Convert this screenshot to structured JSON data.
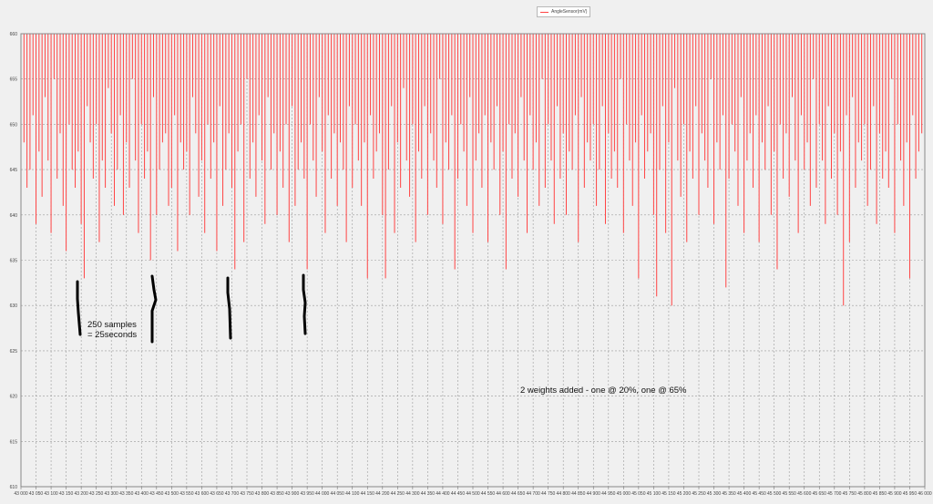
{
  "chart_data": {
    "type": "bar",
    "title": "",
    "legend": {
      "label": "AngleSensor(mV)",
      "color": "#ff4444",
      "position": "top-center"
    },
    "xlabel": "",
    "ylabel": "",
    "ylim": [
      610,
      660
    ],
    "y_ticks": [
      "610",
      "615",
      "620",
      "625",
      "630",
      "635",
      "640",
      "645",
      "650",
      "655",
      "660"
    ],
    "x_tick_labels": [
      "43 000",
      "43 050",
      "43 100",
      "43 150",
      "43 200",
      "43 250",
      "43 300",
      "43 350",
      "43 400",
      "43 450",
      "43 500",
      "43 550",
      "43 600",
      "43 650",
      "43 700",
      "43 750",
      "43 800",
      "43 850",
      "43 900",
      "43 950",
      "44 000",
      "44 050",
      "44 100",
      "44 150",
      "44 200",
      "44 250",
      "44 300",
      "44 350",
      "44 400",
      "44 450",
      "44 500",
      "44 550",
      "44 600",
      "44 650",
      "44 700",
      "44 750",
      "44 800",
      "44 850",
      "44 900",
      "44 950",
      "45 000",
      "45 050",
      "45 100",
      "45 150",
      "45 200",
      "45 250",
      "45 300",
      "45 350",
      "45 400",
      "45 450",
      "45 500",
      "45 550",
      "45 600",
      "45 650",
      "45 700",
      "45 750",
      "45 800",
      "45 850",
      "45 900",
      "45 950",
      "46 000"
    ],
    "x_range": [
      43000,
      46000
    ],
    "grid": true,
    "series": [
      {
        "name": "AngleSensor(mV)",
        "x": [
          43000,
          43010,
          43020,
          43030,
          43040,
          43050,
          43060,
          43070,
          43080,
          43090,
          43100,
          43110,
          43120,
          43130,
          43140,
          43150,
          43160,
          43170,
          43180,
          43190,
          43200,
          43210,
          43220,
          43230,
          43240,
          43250,
          43260,
          43270,
          43280,
          43290,
          43300,
          43310,
          43320,
          43330,
          43340,
          43350,
          43360,
          43370,
          43380,
          43390,
          43400,
          43410,
          43420,
          43430,
          43440,
          43450,
          43460,
          43470,
          43480,
          43490,
          43500,
          43510,
          43520,
          43530,
          43540,
          43550,
          43560,
          43570,
          43580,
          43590,
          43600,
          43610,
          43620,
          43630,
          43640,
          43650,
          43660,
          43670,
          43680,
          43690,
          43700,
          43710,
          43720,
          43730,
          43740,
          43750,
          43760,
          43770,
          43780,
          43790,
          43800,
          43810,
          43820,
          43830,
          43840,
          43850,
          43860,
          43870,
          43880,
          43890,
          43900,
          43910,
          43920,
          43930,
          43940,
          43950,
          43960,
          43970,
          43980,
          43990,
          44000,
          44010,
          44020,
          44030,
          44040,
          44050,
          44060,
          44070,
          44080,
          44090,
          44100,
          44110,
          44120,
          44130,
          44140,
          44150,
          44160,
          44170,
          44180,
          44190,
          44200,
          44210,
          44220,
          44230,
          44240,
          44250,
          44260,
          44270,
          44280,
          44290,
          44300,
          44310,
          44320,
          44330,
          44340,
          44350,
          44360,
          44370,
          44380,
          44390,
          44400,
          44410,
          44420,
          44430,
          44440,
          44450,
          44460,
          44470,
          44480,
          44490,
          44500,
          44510,
          44520,
          44530,
          44540,
          44550,
          44560,
          44570,
          44580,
          44590,
          44600,
          44610,
          44620,
          44630,
          44640,
          44650,
          44660,
          44670,
          44680,
          44690,
          44700,
          44710,
          44720,
          44730,
          44740,
          44750,
          44760,
          44770,
          44780,
          44790,
          44800,
          44810,
          44820,
          44830,
          44840,
          44850,
          44860,
          44870,
          44880,
          44890,
          44900,
          44910,
          44920,
          44930,
          44940,
          44950,
          44960,
          44970,
          44980,
          44990,
          45000,
          45010,
          45020,
          45030,
          45040,
          45050,
          45060,
          45070,
          45080,
          45090,
          45100,
          45110,
          45120,
          45130,
          45140,
          45150,
          45160,
          45170,
          45180,
          45190,
          45200,
          45210,
          45220,
          45230,
          45240,
          45250,
          45260,
          45270,
          45280,
          45290,
          45300,
          45310,
          45320,
          45330,
          45340,
          45350,
          45360,
          45370,
          45380,
          45390,
          45400,
          45410,
          45420,
          45430,
          45440,
          45450,
          45460,
          45470,
          45480,
          45490,
          45500,
          45510,
          45520,
          45530,
          45540,
          45550,
          45560,
          45570,
          45580,
          45590,
          45600,
          45610,
          45620,
          45630,
          45640,
          45650,
          45660,
          45670,
          45680,
          45690,
          45700,
          45710,
          45720,
          45730,
          45740,
          45750,
          45760,
          45770,
          45780,
          45790,
          45800,
          45810,
          45820,
          45830,
          45840,
          45850,
          45860,
          45870,
          45880,
          45890,
          45900,
          45910,
          45920,
          45930,
          45940,
          45950,
          45960,
          45970,
          45980,
          45990
        ],
        "values": [
          634,
          648,
          643,
          645,
          651,
          639,
          647,
          642,
          653,
          646,
          638,
          655,
          644,
          649,
          641,
          636,
          650,
          645,
          643,
          647,
          639,
          633,
          652,
          648,
          644,
          650,
          637,
          646,
          643,
          654,
          649,
          641,
          645,
          651,
          640,
          648,
          643,
          655,
          646,
          638,
          650,
          644,
          647,
          635,
          653,
          640,
          645,
          648,
          649,
          641,
          643,
          651,
          636,
          648,
          645,
          647,
          640,
          653,
          649,
          642,
          646,
          638,
          650,
          644,
          648,
          636,
          652,
          641,
          645,
          649,
          643,
          634,
          647,
          650,
          637,
          655,
          644,
          648,
          642,
          651,
          646,
          639,
          653,
          645,
          649,
          640,
          647,
          643,
          650,
          637,
          652,
          641,
          645,
          648,
          644,
          634,
          650,
          646,
          642,
          653,
          647,
          638,
          651,
          644,
          649,
          641,
          648,
          645,
          637,
          652,
          643,
          650,
          646,
          641,
          648,
          633,
          651,
          644,
          647,
          649,
          640,
          633,
          645,
          652,
          638,
          648,
          643,
          654,
          646,
          642,
          650,
          637,
          647,
          644,
          652,
          640,
          649,
          646,
          643,
          655,
          639,
          648,
          645,
          651,
          634,
          644,
          650,
          647,
          641,
          653,
          638,
          646,
          649,
          643,
          651,
          637,
          648,
          645,
          652,
          640,
          647,
          634,
          650,
          644,
          649,
          642,
          653,
          646,
          638,
          651,
          645,
          648,
          641,
          655,
          643,
          650,
          646,
          639,
          652,
          644,
          649,
          640,
          647,
          645,
          651,
          637,
          653,
          643,
          648,
          646,
          650,
          641,
          645,
          652,
          639,
          649,
          644,
          647,
          643,
          655,
          638,
          650,
          646,
          641,
          648,
          633,
          651,
          644,
          647,
          649,
          640,
          631,
          645,
          652,
          638,
          648,
          630,
          654,
          646,
          642,
          650,
          637,
          647,
          644,
          652,
          640,
          649,
          646,
          643,
          655,
          639,
          648,
          645,
          651,
          632,
          644,
          650,
          647,
          641,
          653,
          638,
          646,
          649,
          643,
          651,
          637,
          648,
          645,
          652,
          640,
          647,
          634,
          650,
          644,
          649,
          642,
          653,
          646,
          638,
          651,
          645,
          648,
          641,
          655,
          643,
          650,
          646,
          639,
          652,
          644,
          649,
          640,
          647,
          630,
          651,
          637,
          653,
          643,
          648,
          646,
          650,
          641,
          645,
          652,
          639,
          649,
          644,
          647,
          643,
          655,
          638,
          650,
          646,
          641,
          648,
          633,
          651,
          644,
          647,
          649
        ]
      }
    ]
  },
  "annotations": {
    "samples_line1": "250 samples",
    "samples_line2": "= 25seconds",
    "weights": "2 weights added - one @ 20%, one @ 65%"
  }
}
